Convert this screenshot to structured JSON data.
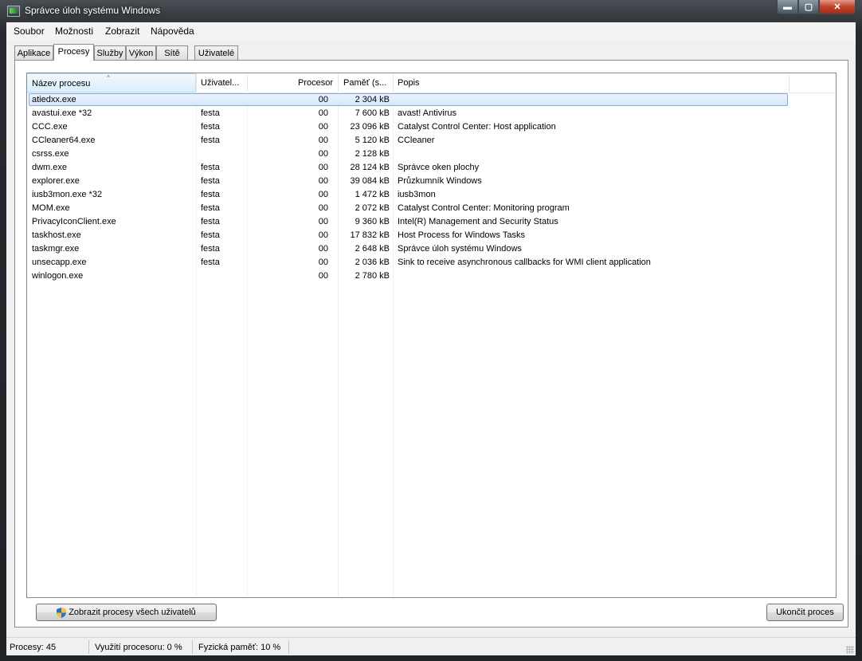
{
  "window": {
    "title": "Správce úloh systému Windows",
    "caption_buttons": {
      "minimize": "▬",
      "maximize": "▢",
      "close": "✕"
    }
  },
  "menu": [
    "Soubor",
    "Možnosti",
    "Zobrazit",
    "Nápověda"
  ],
  "tabs": [
    "Aplikace",
    "Procesy",
    "Služby",
    "Výkon",
    "Sítě",
    "Uživatelé"
  ],
  "active_tab": "Procesy",
  "table": {
    "columns": [
      "Název procesu",
      "Uživatel...",
      "Procesor",
      "Paměť (s...",
      "Popis"
    ],
    "sort_indicator": "^",
    "rows": [
      {
        "name": "atiedxx.exe",
        "user": "",
        "cpu": "00",
        "mem": "2 304 kB",
        "desc": ""
      },
      {
        "name": "avastui.exe *32",
        "user": "festa",
        "cpu": "00",
        "mem": "7 600 kB",
        "desc": "avast! Antivirus"
      },
      {
        "name": "CCC.exe",
        "user": "festa",
        "cpu": "00",
        "mem": "23 096 kB",
        "desc": "Catalyst Control Center: Host application"
      },
      {
        "name": "CCleaner64.exe",
        "user": "festa",
        "cpu": "00",
        "mem": "5 120 kB",
        "desc": "CCleaner"
      },
      {
        "name": "csrss.exe",
        "user": "",
        "cpu": "00",
        "mem": "2 128 kB",
        "desc": ""
      },
      {
        "name": "dwm.exe",
        "user": "festa",
        "cpu": "00",
        "mem": "28 124 kB",
        "desc": "Správce oken plochy"
      },
      {
        "name": "explorer.exe",
        "user": "festa",
        "cpu": "00",
        "mem": "39 084 kB",
        "desc": "Průzkumník Windows"
      },
      {
        "name": "iusb3mon.exe *32",
        "user": "festa",
        "cpu": "00",
        "mem": "1 472 kB",
        "desc": "iusb3mon"
      },
      {
        "name": "MOM.exe",
        "user": "festa",
        "cpu": "00",
        "mem": "2 072 kB",
        "desc": "Catalyst Control Center: Monitoring program"
      },
      {
        "name": "PrivacyIconClient.exe",
        "user": "festa",
        "cpu": "00",
        "mem": "9 360 kB",
        "desc": "Intel(R) Management and Security Status"
      },
      {
        "name": "taskhost.exe",
        "user": "festa",
        "cpu": "00",
        "mem": "17 832 kB",
        "desc": "Host Process for Windows Tasks"
      },
      {
        "name": "taskmgr.exe",
        "user": "festa",
        "cpu": "00",
        "mem": "2 648 kB",
        "desc": "Správce úloh systému Windows"
      },
      {
        "name": "unsecapp.exe",
        "user": "festa",
        "cpu": "00",
        "mem": "2 036 kB",
        "desc": "Sink to receive asynchronous callbacks for WMI client application"
      },
      {
        "name": "winlogon.exe",
        "user": "",
        "cpu": "00",
        "mem": "2 780 kB",
        "desc": ""
      }
    ],
    "selected_index": 0
  },
  "buttons": {
    "show_all": "Zobrazit procesy všech uživatelů",
    "end_process": "Ukončit proces"
  },
  "icons": {
    "show_all_button": "uac-shield-icon"
  },
  "status": {
    "processes": "Procesy: 45",
    "cpu": "Využití procesoru: 0 %",
    "memory": "Fyzická paměť: 10 %"
  }
}
